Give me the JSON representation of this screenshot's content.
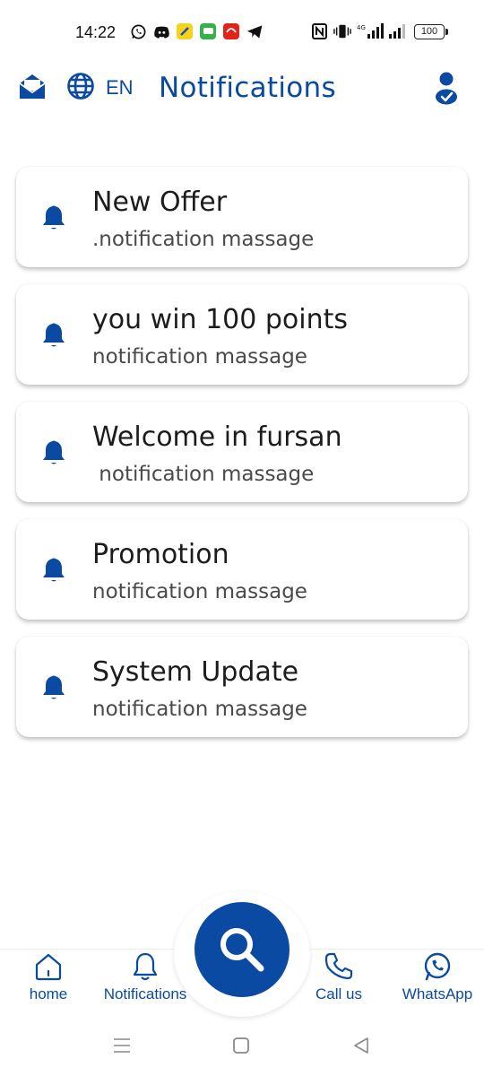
{
  "status_bar": {
    "time": "14:22",
    "left_icons": [
      "whatsapp-icon",
      "discord-icon",
      "yellow-app-icon",
      "messages-app-icon",
      "red-app-icon",
      "telegram-icon"
    ],
    "right_icons": [
      "nfc-icon",
      "vibrate-icon",
      "signal-icon",
      "signal-icon"
    ],
    "battery": "100"
  },
  "header": {
    "language": "EN",
    "title": "Notifications",
    "icons": [
      "inbox-icon",
      "globe-icon",
      "user-check-icon"
    ],
    "accent_color": "#0b4aa2"
  },
  "notifications": [
    {
      "title": "New Offer",
      "message": ".notification massage"
    },
    {
      "title": "you win 100 points",
      "message": "notification massage"
    },
    {
      "title": "Welcome in fursan",
      "message": " notification massage"
    },
    {
      "title": "Promotion",
      "message": "notification massage"
    },
    {
      "title": "System Update",
      "message": "notification massage"
    }
  ],
  "bottom_nav": {
    "home": "home",
    "notifications": "Notifications",
    "search_icon": "search-icon",
    "call_us": "Call us",
    "whatsapp": "WhatsApp"
  },
  "system_nav": {
    "icons": [
      "menu-icon",
      "home-square-icon",
      "back-triangle-icon"
    ]
  }
}
